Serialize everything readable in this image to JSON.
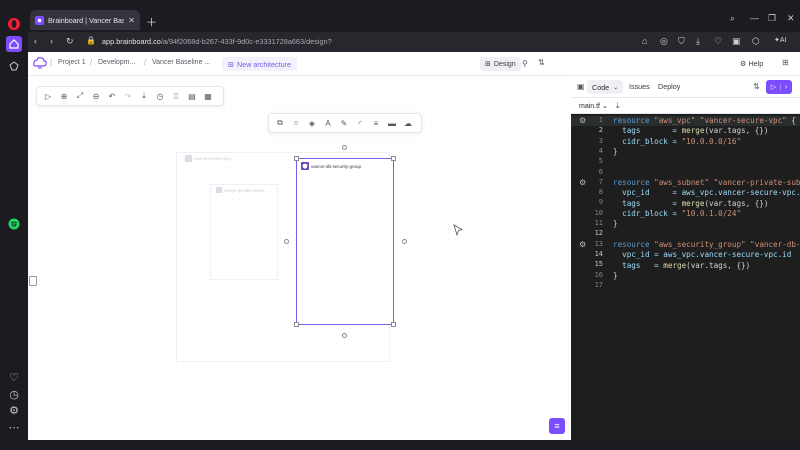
{
  "browser": {
    "tab_title": "Brainboard | Vancer Baseline",
    "url_domain": "app.brainboard.co",
    "url_path": "/a/94f2068d-b267-433f-9d0c-e3331728a663/design?",
    "ai_label": "AI"
  },
  "header": {
    "crumbs": [
      "Project 1",
      "Developm...",
      "Vancer Baseline ..."
    ],
    "new_arch_label": "New architecture",
    "design_label": "Design",
    "help_label": "Help"
  },
  "canvas": {
    "vpc_label": "vancer-secure-vpc",
    "subnet_label": "vancer-private-subnet",
    "sg_label": "vancer-db-security-group"
  },
  "code_panel": {
    "tabs": [
      "Code",
      "Issues",
      "Deploy"
    ],
    "file_name": "main.tf",
    "lines": [
      {
        "n": "1"
      },
      {
        "n": "2"
      },
      {
        "n": "3"
      },
      {
        "n": "4"
      },
      {
        "n": "5"
      },
      {
        "n": "6"
      },
      {
        "n": "7"
      },
      {
        "n": "8"
      },
      {
        "n": "9"
      },
      {
        "n": "10"
      },
      {
        "n": "11"
      },
      {
        "n": "12"
      },
      {
        "n": "13"
      },
      {
        "n": "14"
      },
      {
        "n": "15"
      },
      {
        "n": "16"
      },
      {
        "n": "17"
      }
    ],
    "code": {
      "l1_kw": "resource",
      "l1_s1": "\"aws_vpc\"",
      "l1_s2": "\"vancer-secure-vpc\"",
      "l1_end": " {",
      "l2_key": "  tags       = ",
      "l2_fn": "merge",
      "l2_rest": "(var.tags, {})",
      "l3_key": "  cidr_block = ",
      "l3_str": "\"10.0.0.0/16\"",
      "l4": "}",
      "l6_kw": "resource",
      "l6_s1": "\"aws_subnet\"",
      "l6_s2": "\"vancer-private-subnet\"",
      "l7_key": "  vpc_id     = ",
      "l7_val": "aws_vpc.vancer-secure-vpc.id",
      "l8_key": "  tags       = ",
      "l8_fn": "merge",
      "l8_rest": "(var.tags, {})",
      "l9_key": "  cidr_block = ",
      "l9_str": "\"10.0.1.0/24\"",
      "l10": "}",
      "l12_kw": "resource",
      "l12_s1": "\"aws_security_group\"",
      "l12_s2": "\"vancer-db-secur",
      "l13_key": "  vpc_id = ",
      "l13_val": "aws_vpc.vancer-secure-vpc.id",
      "l14_key": "  tags   = ",
      "l14_fn": "merge",
      "l14_rest": "(var.tags, {})",
      "l15": "}"
    }
  },
  "colors": {
    "accent": "#7c4dff",
    "editor_bg": "#1e1e1e",
    "selection": "#7a5ce6"
  }
}
